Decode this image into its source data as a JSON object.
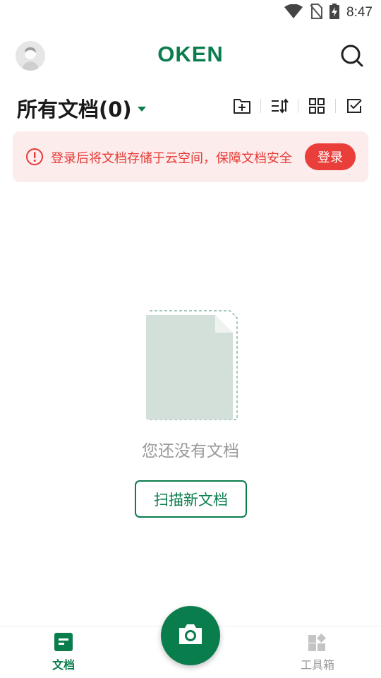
{
  "status_bar": {
    "time": "8:47",
    "icons": [
      "wifi-icon",
      "no-sim-icon",
      "battery-charging-icon"
    ]
  },
  "header": {
    "logo": "OKEN",
    "avatar_icon": "user-avatar-icon",
    "search_icon": "search-icon"
  },
  "documents": {
    "title": "所有文档(0)",
    "toolbar_icons": [
      "new-folder-icon",
      "sort-icon",
      "grid-view-icon",
      "select-icon"
    ]
  },
  "banner": {
    "message": "登录后将文档存储于云空间，保障文档安全",
    "login_label": "登录"
  },
  "empty_state": {
    "message": "您还没有文档",
    "scan_button": "扫描新文档"
  },
  "bottom_nav": {
    "docs_label": "文档",
    "tools_label": "工具箱",
    "camera_icon": "camera-icon"
  },
  "colors": {
    "brand_green": "#0a7d4d",
    "alert_red": "#e53935",
    "banner_bg": "#fdecec"
  }
}
